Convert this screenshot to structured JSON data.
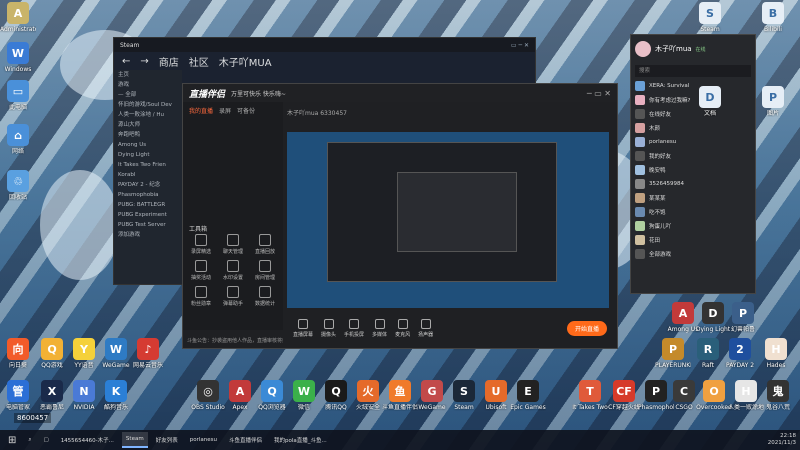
{
  "desktop_left": [
    {
      "label": "Administrator",
      "color": "#c9b46a",
      "glyph": "A"
    },
    {
      "label": "Windows",
      "color": "#3a7bd5",
      "glyph": "W"
    },
    {
      "label": "此电脑",
      "color": "#4a90d9",
      "glyph": "▭"
    },
    {
      "label": "网络",
      "color": "#4a90d9",
      "glyph": "⌂"
    },
    {
      "label": "回收站",
      "color": "#5aa0e0",
      "glyph": "♲"
    }
  ],
  "desktop_right_top": [
    {
      "label": "Steam",
      "color": "#e6eef6",
      "glyph": "S"
    },
    {
      "label": "Bilibili",
      "color": "#e6eef6",
      "glyph": "B"
    },
    {
      "label": "文档",
      "color": "#e6eef6",
      "glyph": "D"
    },
    {
      "label": "图片",
      "color": "#e6eef6",
      "glyph": "P"
    }
  ],
  "desktop_bottom_row1": [
    {
      "label": "向日葵",
      "color": "#f25b2a",
      "glyph": "向"
    },
    {
      "label": "QQ游戏",
      "color": "#f2b134",
      "glyph": "Q"
    },
    {
      "label": "YY语音",
      "color": "#f5d13a",
      "glyph": "Y"
    },
    {
      "label": "WeGame",
      "color": "#2e7bc4",
      "glyph": "W"
    },
    {
      "label": "网易云音乐",
      "color": "#d53b32",
      "glyph": "♪"
    },
    {
      "label": "Among Us",
      "color": "#c23a3a",
      "glyph": "A"
    },
    {
      "label": "Dying Light",
      "color": "#333",
      "glyph": "D"
    },
    {
      "label": "幻兽帕鲁",
      "color": "#3b5f8a",
      "glyph": "P"
    },
    {
      "label": "PLAYERUNKNOWN'S",
      "color": "#c48a2a",
      "glyph": "P"
    },
    {
      "label": "Raft",
      "color": "#2a5f7a",
      "glyph": "R"
    },
    {
      "label": "PAYDAY 2",
      "color": "#1f4f9e",
      "glyph": "2"
    },
    {
      "label": "Hades",
      "color": "#f0e0d0",
      "glyph": "H"
    }
  ],
  "desktop_bottom_row2": [
    {
      "label": "电脑管家",
      "color": "#2b6fd6",
      "glyph": "管"
    },
    {
      "label": "恶霸鲁尼",
      "color": "#1a2a4a",
      "glyph": "X"
    },
    {
      "label": "NVIDIA",
      "color": "#4a7ad6",
      "glyph": "N"
    },
    {
      "label": "酷狗音乐",
      "color": "#2b7fd6",
      "glyph": "K"
    },
    {
      "label": "OBS Studio",
      "color": "#333",
      "glyph": "◎"
    },
    {
      "label": "Apex",
      "color": "#c23a3a",
      "glyph": "A"
    },
    {
      "label": "QQ浏览器",
      "color": "#3b8ad6",
      "glyph": "Q"
    },
    {
      "label": "微信",
      "color": "#3bb04a",
      "glyph": "W"
    },
    {
      "label": "腾讯QQ",
      "color": "#1a1a1a",
      "glyph": "Q"
    },
    {
      "label": "火绒安全",
      "color": "#e56a2a",
      "glyph": "火"
    },
    {
      "label": "斗鱼直播伴侣",
      "color": "#f07a2a",
      "glyph": "鱼"
    },
    {
      "label": "WeGame",
      "color": "#c24a4a",
      "glyph": "G"
    },
    {
      "label": "Steam",
      "color": "#1b2838",
      "glyph": "S"
    },
    {
      "label": "Ubisoft",
      "color": "#e56a2a",
      "glyph": "U"
    },
    {
      "label": "Epic Games",
      "color": "#222",
      "glyph": "E"
    },
    {
      "label": "It Takes Two",
      "color": "#e05a3a",
      "glyph": "T"
    },
    {
      "label": "CF穿越火线",
      "color": "#d63a2a",
      "glyph": "CF"
    },
    {
      "label": "Phasmophobia",
      "color": "#222",
      "glyph": "P"
    },
    {
      "label": "CSGO",
      "color": "#3a3a3a",
      "glyph": "C"
    },
    {
      "label": "Overcooked",
      "color": "#f0a040",
      "glyph": "O"
    },
    {
      "label": "人类一败涂地",
      "color": "#e6e6e6",
      "glyph": "H"
    },
    {
      "label": "鬼谷八荒",
      "color": "#333",
      "glyph": "鬼"
    }
  ],
  "steam": {
    "title": "Steam",
    "nav": [
      "←",
      "→",
      "商店",
      "社区",
      "木子吖MUA"
    ],
    "library_items": [
      "主页",
      "游戏",
      "— 全部",
      "怀旧的游戏/Soul Dev",
      "人类一败涂地 / Hu",
      "源山大师",
      "奔跑吧鸭",
      "Among Us",
      "Dying Light",
      "It Takes Two Frien",
      "Korabl",
      "PAYDAY 2 - 纪念",
      "Phasmophobia",
      "PUBG: BATTLEGR",
      "PUBG Experiment",
      "PUBG Test Server",
      "添加游戏"
    ]
  },
  "douyu": {
    "logo": "直播伴侣",
    "room_title": "万里可快乐 快乐嗨~",
    "room_meta": "木子吖mua   6330457",
    "tabs": [
      "我的直播",
      "录屏",
      "可备份"
    ],
    "toolbox_title": "工具箱",
    "tools": [
      "录屏精选",
      "聊天管理",
      "直播回放",
      "抽奖活动",
      "水印设置",
      "房间管理",
      "粉丝勋章",
      "弹幕助手",
      "数据统计"
    ],
    "bottom_tools": [
      "直播屏幕",
      "摄像头",
      "手机投屏",
      "多媒体",
      "麦克风",
      "扬声器"
    ],
    "start_label": "开始直播",
    "notice": "斗鱼公告：抄袭盗用他人作品，直播审核将封禁"
  },
  "qq": {
    "name": "木子吖mua",
    "status": "在线",
    "search_placeholder": "搜索",
    "items": [
      {
        "name": "XERA: Survival",
        "msg": ""
      },
      {
        "name": "你有考虑过我嘛?",
        "msg": "XERA: Survival"
      },
      {
        "name": "在线好友",
        "msg": ""
      },
      {
        "name": "木颜",
        "msg": ""
      },
      {
        "name": "porlanesu",
        "msg": ""
      },
      {
        "name": "我的好友",
        "msg": ""
      },
      {
        "name": "晚安鸭",
        "msg": ""
      },
      {
        "name": "3526459984",
        "msg": ""
      },
      {
        "name": "某某某",
        "msg": ""
      },
      {
        "name": "吃不饱",
        "msg": ""
      },
      {
        "name": "狗蛋儿吖",
        "msg": ""
      },
      {
        "name": "花田",
        "msg": ""
      },
      {
        "name": "全部游戏",
        "msg": ""
      }
    ]
  },
  "taskbar": {
    "items": [
      "1455654460-木子...",
      "Steam",
      "好友列表",
      "porlanesu",
      "斗鱼直播伴侣",
      "我的pola直播_斗鱼..."
    ],
    "time": "22:18",
    "date": "2021/11/3"
  },
  "stream_badge": "8600457"
}
